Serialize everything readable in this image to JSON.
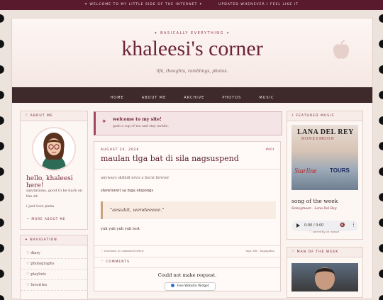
{
  "topbar": {
    "left": "✦ WELCOME TO MY LITTLE SIDE OF THE INTERNET ✦",
    "right": "UPDATED WHENEVER I FEEL LIKE IT"
  },
  "header": {
    "tagline": "✦ BASICALLY EVERYTHING ✦",
    "title": "khaleesi's corner",
    "subtitle": "life, thoughts, ramblings, photos."
  },
  "nav": [
    "HOME",
    "ABOUT ME",
    "ARCHIVE",
    "PHOTOS",
    "MUSIC"
  ],
  "about": {
    "heading": "♡ ABOUT ME",
    "greeting": "hello, khaleesi here!",
    "text1": "salutations, good to be back on the sit.",
    "text2": "i just love pizza",
    "more": "— MORE ABOUT ME"
  },
  "navigation": {
    "heading": "✦ NAVIGATION",
    "items": [
      "♡ diary",
      "♡ photographs",
      "♡ playlists",
      "♡ favorites"
    ]
  },
  "welcome": {
    "icon": "✦",
    "title": "welcome to my site!",
    "text": "grab a cup of tea and stay awhile."
  },
  "post": {
    "date": "AUGUST 24, 2026",
    "number": "#001",
    "title": "maulan tlga bat di sila nagsuspend",
    "p1": "anyways skibidi ervis x buriz forever",
    "p2": "showtoowt sa mga olopongs",
    "quote": "\"aesukit, wendeeeee.\"",
    "p3": "yuh yuh yuh yuh test",
    "footer_left": "♡ reactions & comments below",
    "footer_right": "tags: life , bagagulan",
    "comments_heading": "♡ COMMENTS",
    "comments_error": "Could not make request.",
    "widget_label": "Free Website Widget"
  },
  "featured": {
    "heading": "♪ FEATURED MUSIC",
    "album_artist": "LANA DEL REY",
    "album_title": "HONEYMOON",
    "album_word1": "Starline",
    "album_word2": "TOURS",
    "song_heading": "song of the week",
    "song_name": "Honeymoon - Lana Del Rey",
    "player_time": "0:00 / 0:00",
    "caption": "♡ currently on repeat"
  },
  "man_of_week": {
    "heading": "♡ MAN OF THE WEEK"
  }
}
